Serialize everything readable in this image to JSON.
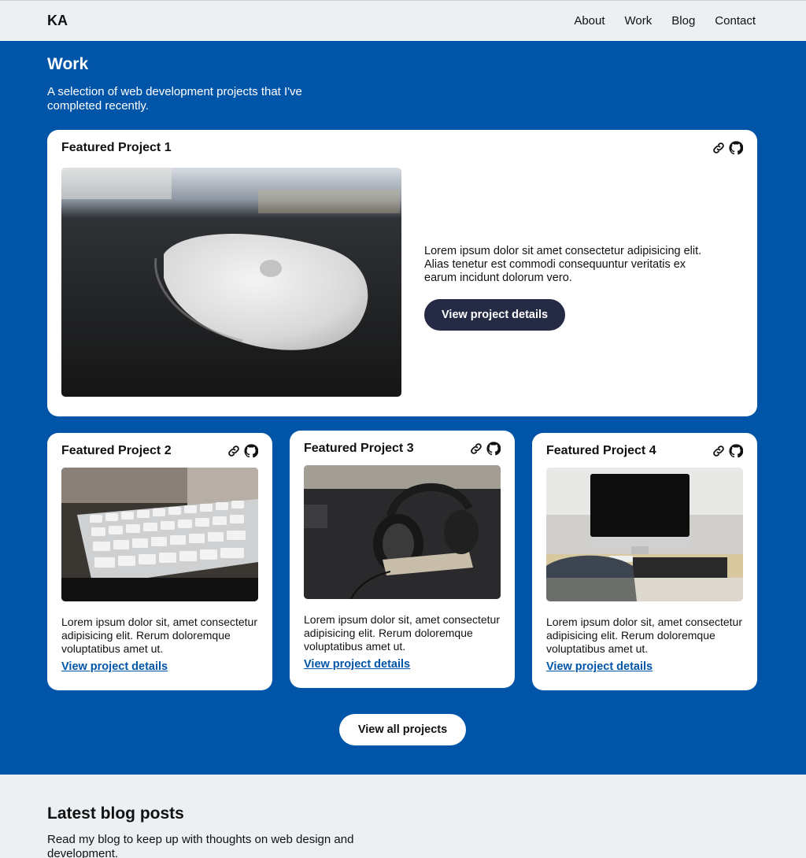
{
  "header": {
    "logo": "KA",
    "nav": [
      "About",
      "Work",
      "Blog",
      "Contact"
    ]
  },
  "work": {
    "title": "Work",
    "intro": "A selection of web development projects that I've completed recently.",
    "featured": {
      "title": "Featured Project 1",
      "description": "Lorem ipsum dolor sit amet consectetur adipisicing elit. Alias tenetur est commodi consequuntur veritatis ex earum incidunt dolorum vero.",
      "button": "View project details"
    },
    "projects": [
      {
        "title": "Featured Project 2",
        "description": "Lorem ipsum dolor sit, amet consectetur adipisicing elit. Rerum doloremque voluptatibus amet ut.",
        "link": "View project details"
      },
      {
        "title": "Featured Project 3",
        "description": "Lorem ipsum dolor sit, amet consectetur adipisicing elit. Rerum doloremque voluptatibus amet ut.",
        "link": "View project details"
      },
      {
        "title": "Featured Project 4",
        "description": "Lorem ipsum dolor sit, amet consectetur adipisicing elit. Rerum doloremque voluptatibus amet ut.",
        "link": "View project details"
      }
    ],
    "view_all": "View all projects"
  },
  "blog": {
    "title": "Latest blog posts",
    "intro": "Read my blog to keep up with thoughts on web design and development."
  },
  "colors": {
    "brand_blue": "#0055A8",
    "dark_button": "#262B45",
    "page_bg": "#ECF0F3"
  },
  "icons": [
    "link-icon",
    "github-icon"
  ]
}
